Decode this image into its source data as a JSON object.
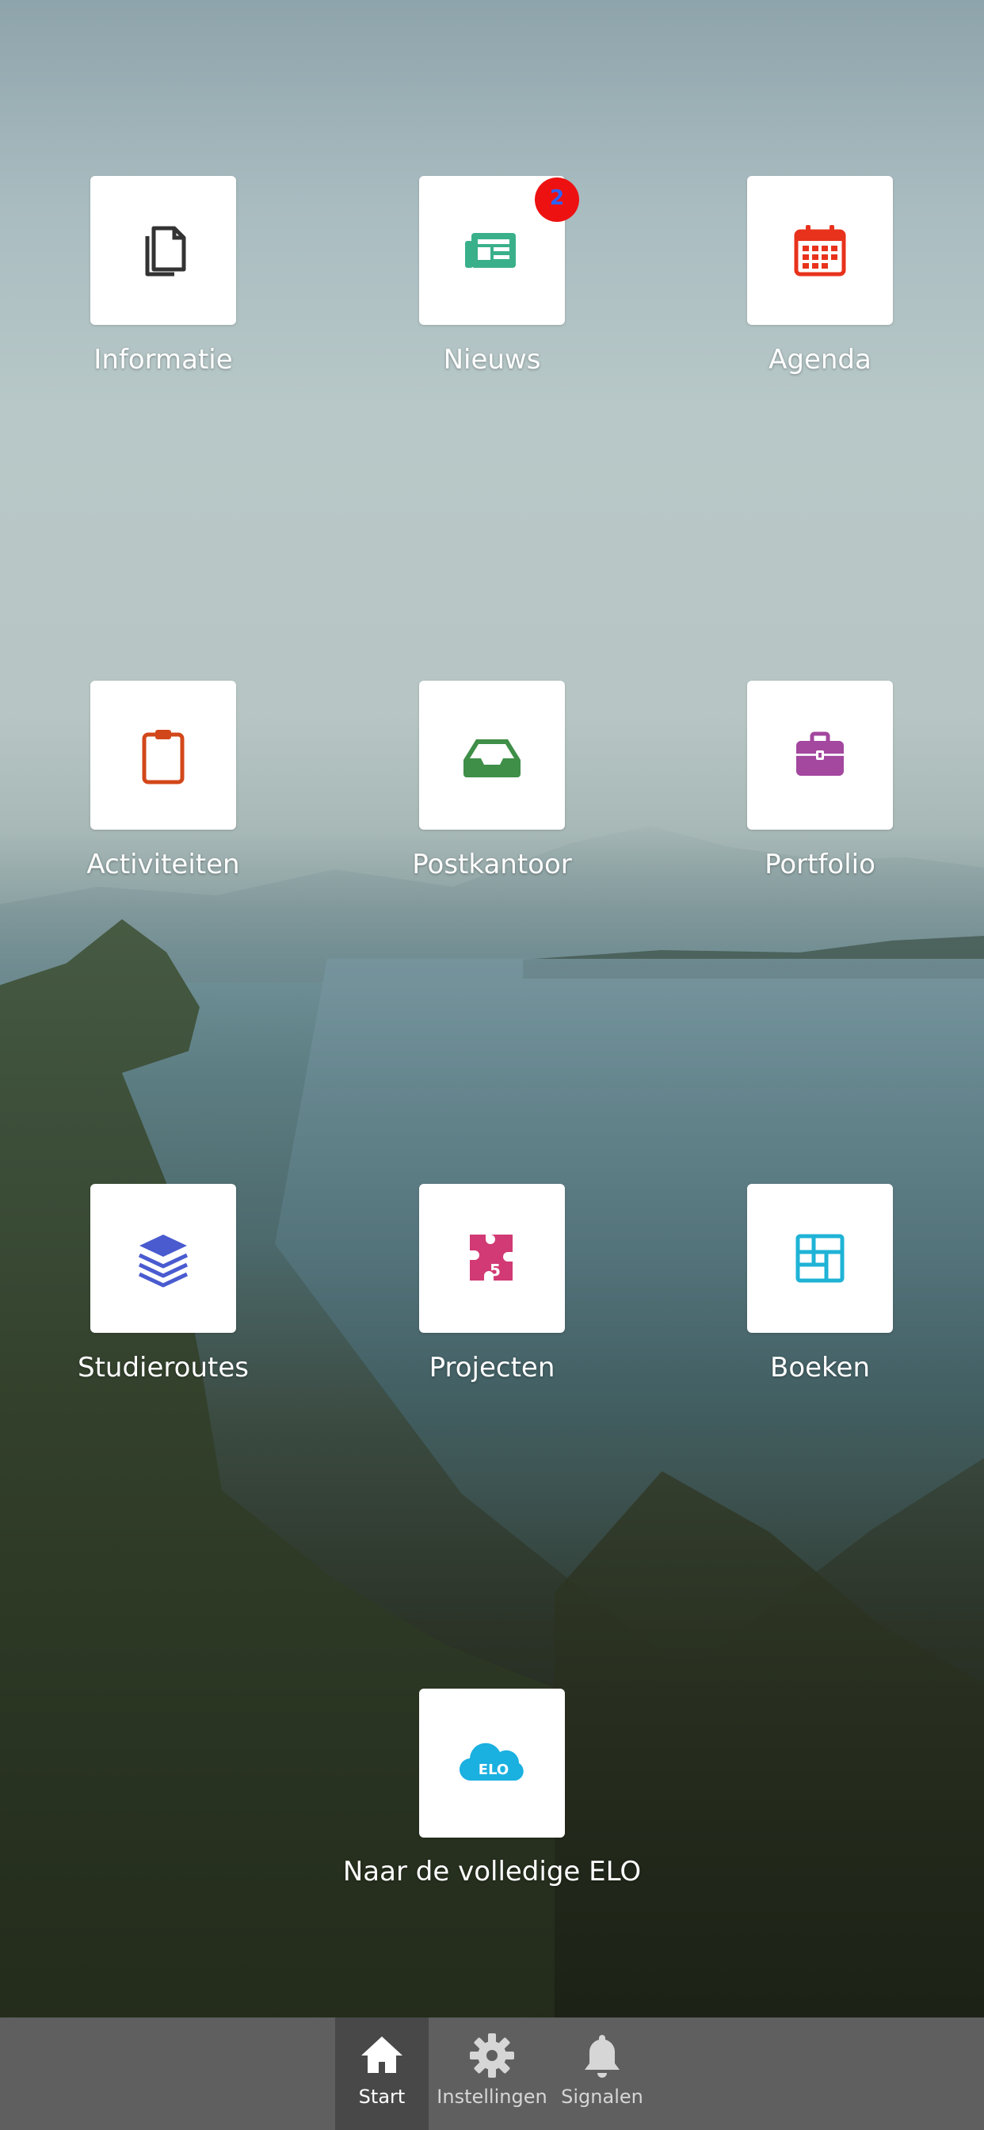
{
  "tiles": [
    {
      "label": "Informatie",
      "icon": "copy-documents-icon",
      "color": "#333333"
    },
    {
      "label": "Nieuws",
      "icon": "newspaper-icon",
      "color": "#3ab08a",
      "badge": "2"
    },
    {
      "label": "Agenda",
      "icon": "calendar-icon",
      "color": "#e8321c"
    },
    {
      "label": "Activiteiten",
      "icon": "clipboard-icon",
      "color": "#d2471a"
    },
    {
      "label": "Postkantoor",
      "icon": "inbox-tray-icon",
      "color": "#3f8f48"
    },
    {
      "label": "Portfolio",
      "icon": "briefcase-icon",
      "color": "#a3479f"
    },
    {
      "label": "Studieroutes",
      "icon": "layers-stack-icon",
      "color": "#4a5bd0"
    },
    {
      "label": "Projecten",
      "icon": "puzzle-piece-icon",
      "color": "#d13a74"
    },
    {
      "label": "Boeken",
      "icon": "layout-grid-icon",
      "color": "#1fb3d6"
    },
    {
      "label": "Naar de volledige ELO",
      "icon": "elo-cloud-icon",
      "color": "#1ab0e0",
      "icon_text": "ELO"
    }
  ],
  "tabbar": {
    "items": [
      {
        "label": "Start",
        "icon": "home-icon",
        "active": true
      },
      {
        "label": "Instellingen",
        "icon": "gear-icon",
        "active": false
      },
      {
        "label": "Signalen",
        "icon": "bell-icon",
        "active": false
      }
    ]
  }
}
